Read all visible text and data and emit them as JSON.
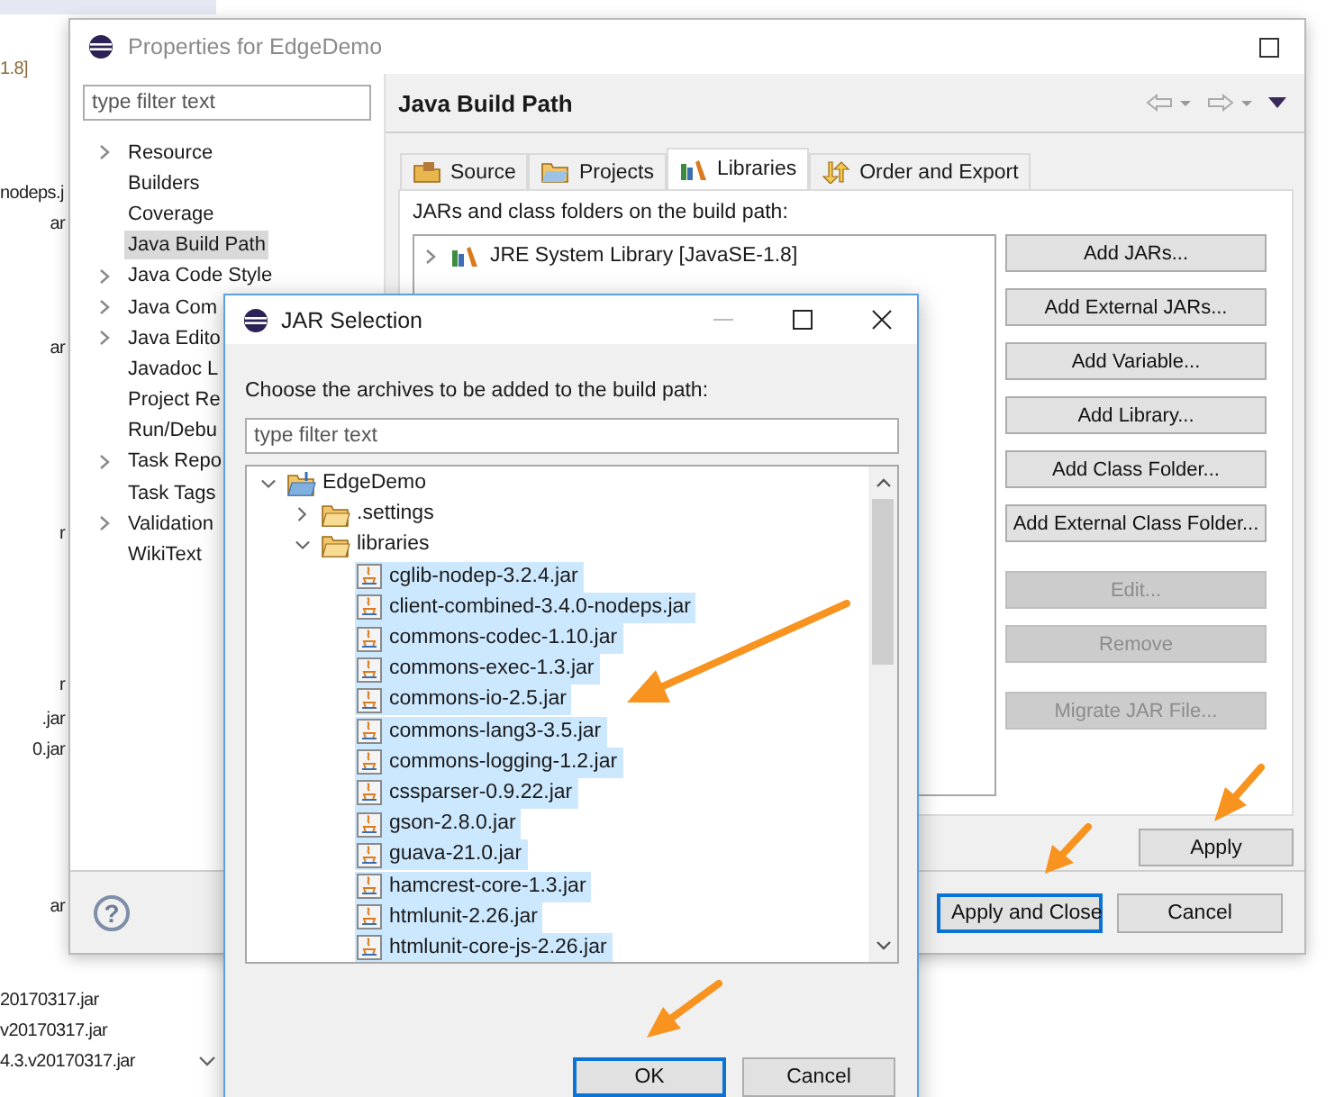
{
  "background_editor": {
    "lines": [
      "1.8]",
      "nodeps.j",
      "ar",
      "ar",
      "r",
      "r",
      ".jar",
      "0.jar",
      "ar",
      "20170317.jar",
      "v20170317.jar",
      "4.3.v20170317.jar"
    ]
  },
  "properties_window": {
    "title": "Properties for EdgeDemo",
    "filter": {
      "placeholder": "type filter text"
    },
    "nav_items": [
      {
        "label": "Resource",
        "expandable": true,
        "selected": false
      },
      {
        "label": "Builders",
        "expandable": false,
        "selected": false
      },
      {
        "label": "Coverage",
        "expandable": false,
        "selected": false
      },
      {
        "label": "Java Build Path",
        "expandable": false,
        "selected": true
      },
      {
        "label": "Java Code Style",
        "expandable": true,
        "selected": false
      },
      {
        "label": "Java Com",
        "expandable": true,
        "selected": false
      },
      {
        "label": "Java Edito",
        "expandable": true,
        "selected": false
      },
      {
        "label": "Javadoc L",
        "expandable": false,
        "selected": false
      },
      {
        "label": "Project Re",
        "expandable": false,
        "selected": false
      },
      {
        "label": "Run/Debu",
        "expandable": false,
        "selected": false
      },
      {
        "label": "Task Repo",
        "expandable": true,
        "selected": false
      },
      {
        "label": "Task Tags",
        "expandable": false,
        "selected": false
      },
      {
        "label": "Validation",
        "expandable": true,
        "selected": false
      },
      {
        "label": "WikiText",
        "expandable": false,
        "selected": false
      }
    ],
    "page_title": "Java Build Path",
    "tabs": [
      {
        "label": "Source",
        "selected": false
      },
      {
        "label": "Projects",
        "selected": false
      },
      {
        "label": "Libraries",
        "selected": true
      },
      {
        "label": "Order and Export",
        "selected": false
      }
    ],
    "description": "JARs and class folders on the build path:",
    "libraries": [
      {
        "label": "JRE System Library [JavaSE-1.8]",
        "expanded": false
      }
    ],
    "side_buttons": [
      {
        "label": "Add JARs...",
        "disabled": false
      },
      {
        "label": "Add External JARs...",
        "disabled": false
      },
      {
        "label": "Add Variable...",
        "disabled": false
      },
      {
        "label": "Add Library...",
        "disabled": false
      },
      {
        "label": "Add Class Folder...",
        "disabled": false
      },
      {
        "label": "Add External Class Folder...",
        "disabled": false
      },
      {
        "label": "Edit...",
        "disabled": true
      },
      {
        "label": "Remove",
        "disabled": true
      },
      {
        "label": "Migrate JAR File...",
        "disabled": true
      }
    ],
    "apply_button": "Apply",
    "help_button": "?",
    "bottom_buttons": [
      {
        "label": "Apply and Close",
        "default": true
      },
      {
        "label": "Cancel",
        "default": false
      }
    ]
  },
  "jar_dialog": {
    "title": "JAR Selection",
    "instruction": "Choose the archives to be added to the build path:",
    "filter": {
      "placeholder": "type filter text"
    },
    "tree": [
      {
        "label": "EdgeDemo",
        "kind": "project",
        "expanded": true,
        "selected": false,
        "children": [
          {
            "label": ".settings",
            "kind": "folder",
            "expanded": false,
            "selected": false
          },
          {
            "label": "libraries",
            "kind": "folder",
            "expanded": true,
            "selected": false,
            "children": [
              {
                "label": "cglib-nodep-3.2.4.jar",
                "kind": "jar",
                "selected": true
              },
              {
                "label": "client-combined-3.4.0-nodeps.jar",
                "kind": "jar",
                "selected": true
              },
              {
                "label": "commons-codec-1.10.jar",
                "kind": "jar",
                "selected": true
              },
              {
                "label": "commons-exec-1.3.jar",
                "kind": "jar",
                "selected": true
              },
              {
                "label": "commons-io-2.5.jar",
                "kind": "jar",
                "selected": true
              },
              {
                "label": "commons-lang3-3.5.jar",
                "kind": "jar",
                "selected": true
              },
              {
                "label": "commons-logging-1.2.jar",
                "kind": "jar",
                "selected": true
              },
              {
                "label": "cssparser-0.9.22.jar",
                "kind": "jar",
                "selected": true
              },
              {
                "label": "gson-2.8.0.jar",
                "kind": "jar",
                "selected": true
              },
              {
                "label": "guava-21.0.jar",
                "kind": "jar",
                "selected": true
              },
              {
                "label": "hamcrest-core-1.3.jar",
                "kind": "jar",
                "selected": true
              },
              {
                "label": "htmlunit-2.26.jar",
                "kind": "jar",
                "selected": true
              },
              {
                "label": "htmlunit-core-js-2.26.jar",
                "kind": "jar",
                "selected": true
              }
            ]
          }
        ]
      }
    ],
    "buttons": [
      {
        "label": "OK",
        "default": true
      },
      {
        "label": "Cancel",
        "default": false
      }
    ]
  }
}
